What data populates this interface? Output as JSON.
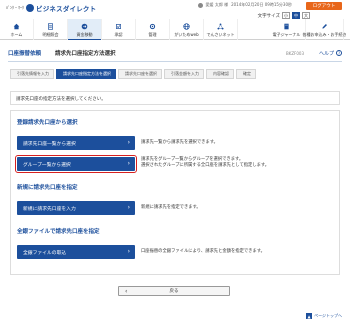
{
  "header": {
    "bank_mark": "ﾊﾞﾝｸ・ﾏｰｸ",
    "brand": "ビジネスダイレクト",
    "user": "愛媛 太郎 様",
    "last_login": "2014年02月20日 09時15分30秒",
    "logout_label": "ログアウト",
    "textsize_label": "文字サイズ",
    "textsize_options": [
      "小",
      "中",
      "大"
    ]
  },
  "nav": [
    {
      "label": "ホーム"
    },
    {
      "label": "明細照会"
    },
    {
      "label": "資金移動"
    },
    {
      "label": "承認"
    },
    {
      "label": "管理"
    },
    {
      "label": "がいためweb"
    },
    {
      "label": "でんさいネット"
    }
  ],
  "nav_right": [
    {
      "label": "電子ジャーナル"
    },
    {
      "label": "各種お申込み・お手続き"
    }
  ],
  "title": {
    "category": "口座振替依頼",
    "page": "請求先口座指定方法選択",
    "code": "BKZF003",
    "help": "ヘルプ"
  },
  "steps": [
    "引落先情報を入力",
    "請求先口座指定方法を選択",
    "請求先口座を選択",
    "引落金額を入力",
    "内容確認",
    "確定"
  ],
  "instruction": "請求先口座の指定方法を選択してください。",
  "sections": {
    "registered": {
      "title": "登録請求先口座から選択",
      "list_btn": "請求先口座一覧から選択",
      "list_desc": "請求先一覧から請求先を選択できます。",
      "group_btn": "グループ一覧から選択",
      "group_desc1": "請求先をグループ一覧からグループを選択できます。",
      "group_desc2": "選択されたグループに所属する全口座を請求先として指定します。"
    },
    "new": {
      "title": "新規に請求先口座を指定",
      "btn": "新規に請求先口座を入力",
      "desc": "新規に請求先を指定できます。"
    },
    "file": {
      "title": "全銀ファイルで請求先口座を指定",
      "btn": "全銀ファイルの取込",
      "desc": "口座振替の全銀ファイルにより、請求先と金額を指定できます。"
    }
  },
  "back_label": "戻る",
  "pagetop_label": "ページトップへ"
}
